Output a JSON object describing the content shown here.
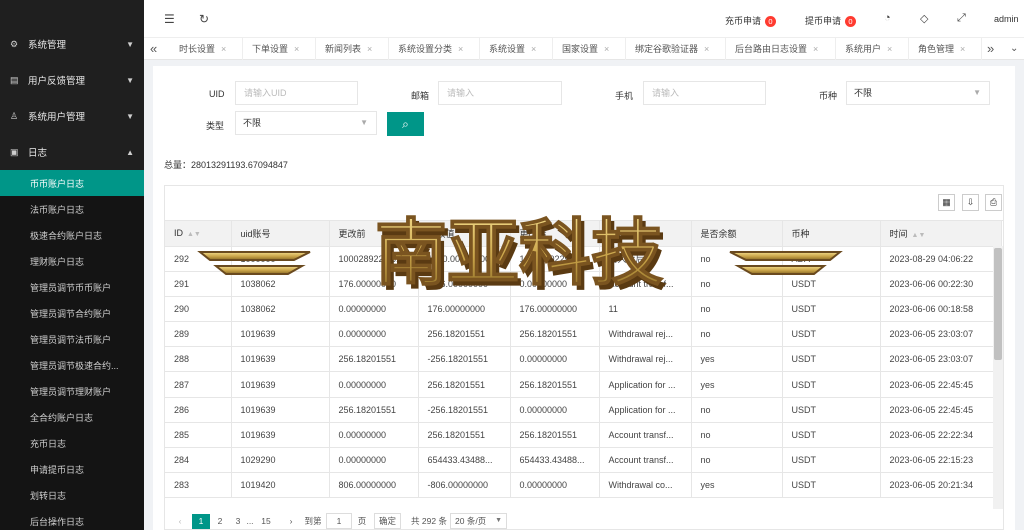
{
  "sidebar": {
    "groups": [
      {
        "label": "系统管理",
        "icon": "gear-icon"
      },
      {
        "label": "用户反馈管理",
        "icon": "feedback-icon"
      },
      {
        "label": "系统用户管理",
        "icon": "user-icon"
      },
      {
        "label": "日志",
        "icon": "log-icon"
      }
    ],
    "items": [
      "币币账户日志",
      "法币账户日志",
      "极速合约账户日志",
      "理财账户日志",
      "管理员调节币币账户",
      "管理员调节合约账户",
      "管理员调节法币账户",
      "管理员调节极速合约...",
      "管理员调节理财账户",
      "全合约账户日志",
      "充币日志",
      "申请提币日志",
      "划转日志",
      "后台操作日志"
    ]
  },
  "topbar": {
    "deposit_label": "充币申请",
    "deposit_count": "0",
    "withdraw_label": "提币申请",
    "withdraw_count": "0",
    "user": "admin"
  },
  "tabs": [
    "时长设置",
    "下单设置",
    "新闻列表",
    "系统设置分类",
    "系统设置",
    "国家设置",
    "绑定谷歌验证器",
    "后台路由日志设置",
    "系统用户",
    "角色管理"
  ],
  "filters": {
    "uid_label": "UID",
    "uid_placeholder": "请输入UID",
    "email_label": "邮箱",
    "email_placeholder": "请输入",
    "phone_label": "手机",
    "phone_placeholder": "请输入",
    "currency_label": "币种",
    "currency_value": "不限",
    "type_label": "类型",
    "type_value": "不限"
  },
  "total_text": "总量：28013291193.67094847",
  "table": {
    "columns": [
      "ID",
      "uid账号",
      "更改前",
      "更改值",
      "更改后",
      "备注",
      "是否余额",
      "币种",
      "时间"
    ],
    "rows": [
      [
        "292",
        "1000000",
        "1000289229.6...",
        "1000.00000000",
        "1000290229.6...",
        "增大太后",
        "no",
        "ADA",
        "2023-08-29 04:06:22"
      ],
      [
        "291",
        "1038062",
        "176.00000000",
        "-176.00000000",
        "0.00000000",
        "Account transf...",
        "no",
        "USDT",
        "2023-06-06 00:22:30"
      ],
      [
        "290",
        "1038062",
        "0.00000000",
        "176.00000000",
        "176.00000000",
        "11",
        "no",
        "USDT",
        "2023-06-06 00:18:58"
      ],
      [
        "289",
        "1019639",
        "0.00000000",
        "256.18201551",
        "256.18201551",
        "Withdrawal rej...",
        "no",
        "USDT",
        "2023-06-05 23:03:07"
      ],
      [
        "288",
        "1019639",
        "256.18201551",
        "-256.18201551",
        "0.00000000",
        "Withdrawal rej...",
        "yes",
        "USDT",
        "2023-06-05 23:03:07"
      ],
      [
        "287",
        "1019639",
        "0.00000000",
        "256.18201551",
        "256.18201551",
        "Application for ...",
        "yes",
        "USDT",
        "2023-06-05 22:45:45"
      ],
      [
        "286",
        "1019639",
        "256.18201551",
        "-256.18201551",
        "0.00000000",
        "Application for ...",
        "no",
        "USDT",
        "2023-06-05 22:45:45"
      ],
      [
        "285",
        "1019639",
        "0.00000000",
        "256.18201551",
        "256.18201551",
        "Account transf...",
        "no",
        "USDT",
        "2023-06-05 22:22:34"
      ],
      [
        "284",
        "1029290",
        "0.00000000",
        "654433.43488...",
        "654433.43488...",
        "Account transf...",
        "no",
        "USDT",
        "2023-06-05 22:15:23"
      ],
      [
        "283",
        "1019420",
        "806.00000000",
        "-806.00000000",
        "0.00000000",
        "Withdrawal co...",
        "yes",
        "USDT",
        "2023-06-05 20:21:34"
      ]
    ]
  },
  "pager": {
    "pages": [
      "1",
      "2",
      "3",
      "...",
      "15"
    ],
    "goto_label": "到第",
    "page_value": "1",
    "page_unit": "页",
    "confirm_label": "确定",
    "total_label": "共 292 条",
    "size_value": "20 条/页"
  },
  "watermark": {
    "text": "南亚科技"
  },
  "colors": {
    "accent": "#009688",
    "sidebar_bg": "#1f1f1f",
    "badge": "#ff3b30"
  }
}
